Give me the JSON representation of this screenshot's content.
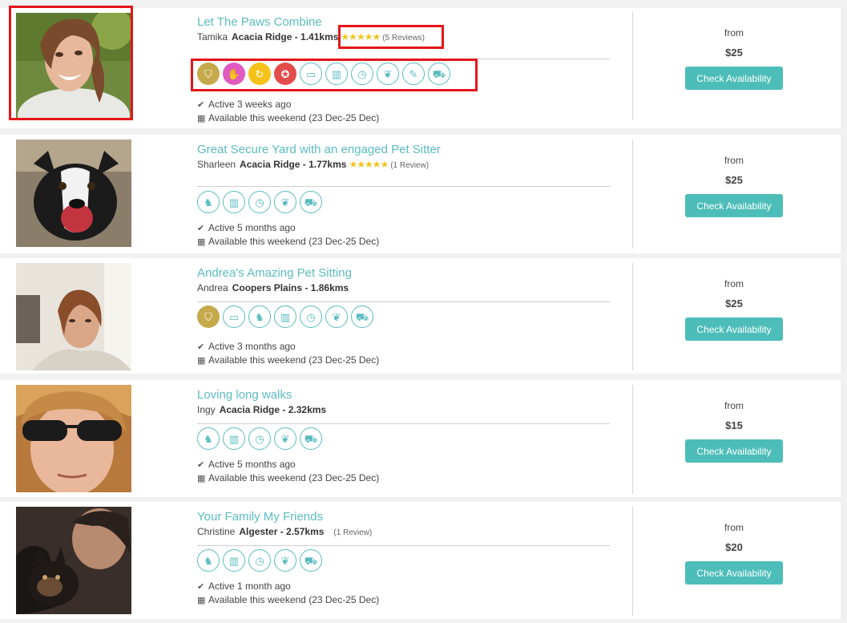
{
  "listings": [
    {
      "title": "Let The Paws Combine",
      "name": "Tamika",
      "location": "Acacia Ridge - 1.41kms",
      "stars": "★★★★★",
      "reviews": "(5 Reviews)",
      "icons": [
        "shield-badge",
        "handshake-badge",
        "refresh-badge",
        "award-badge",
        "car-icon",
        "fence-icon",
        "clock-icon",
        "paw-icon",
        "syringe-icon",
        "ambulance-icon"
      ],
      "active": "Active 3 weeks ago",
      "available": "Available this weekend (23 Dec-25 Dec)",
      "from": "from",
      "price": "$25",
      "cta": "Check Availability"
    },
    {
      "title": "Great Secure Yard with an engaged Pet Sitter",
      "name": "Sharleen",
      "location": "Acacia Ridge - 1.77kms",
      "stars": "★★★★★",
      "reviews": "(1 Review)",
      "icons": [
        "dog-icon",
        "fence-icon",
        "clock-icon",
        "paw-icon",
        "ambulance-icon"
      ],
      "active": "Active 5 months ago",
      "available": "Available this weekend (23 Dec-25 Dec)",
      "from": "from",
      "price": "$25",
      "cta": "Check Availability"
    },
    {
      "title": "Andrea's Amazing Pet Sitting",
      "name": "Andrea",
      "location": "Coopers Plains - 1.86kms",
      "stars": "",
      "reviews": "",
      "icons": [
        "shield-badge",
        "car-icon",
        "dog-icon",
        "fence-icon",
        "clock-icon",
        "paw-icon",
        "ambulance-icon"
      ],
      "active": "Active 3 months ago",
      "available": "Available this weekend (23 Dec-25 Dec)",
      "from": "from",
      "price": "$25",
      "cta": "Check Availability"
    },
    {
      "title": "Loving long walks",
      "name": "Ingy",
      "location": "Acacia Ridge - 2.32kms",
      "stars": "",
      "reviews": "",
      "icons": [
        "dog-icon",
        "fence-icon",
        "clock-icon",
        "paw-icon",
        "ambulance-icon"
      ],
      "active": "Active 5 months ago",
      "available": "Available this weekend (23 Dec-25 Dec)",
      "from": "from",
      "price": "$15",
      "cta": "Check Availability"
    },
    {
      "title": "Your Family My Friends",
      "name": "Christine",
      "location": "Algester - 2.57kms",
      "stars": "",
      "reviews": "(1 Review)",
      "icons": [
        "dog-icon",
        "fence-icon",
        "clock-icon",
        "paw-icon",
        "ambulance-icon"
      ],
      "active": "Active 1 month ago",
      "available": "Available this weekend (23 Dec-25 Dec)",
      "from": "from",
      "price": "$20",
      "cta": "Check Availability"
    }
  ],
  "colors": {
    "accent": "#5bbcc0",
    "button": "#4dbdb9",
    "star": "#f4c21b",
    "highlight": "#e3151a"
  }
}
